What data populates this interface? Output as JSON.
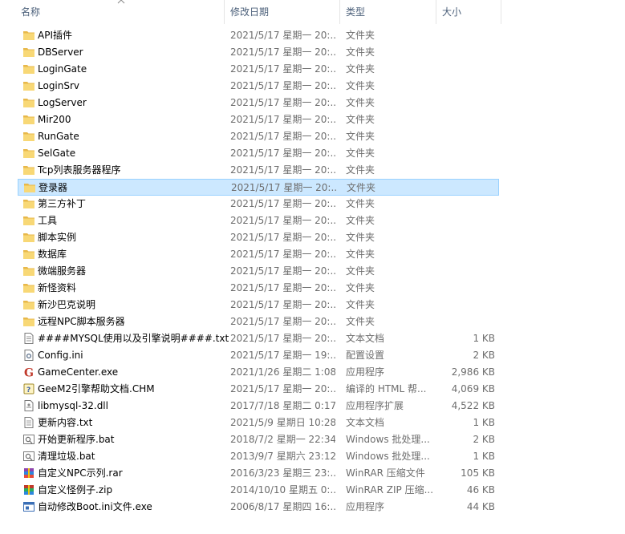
{
  "columns": {
    "name": "名称",
    "date": "修改日期",
    "type": "类型",
    "size": "大小"
  },
  "selected_index": 9,
  "icon_colors": {
    "folder": "#f8d876",
    "folder_dark": "#e8b84a",
    "selected_bg": "#cce8ff"
  },
  "rows": [
    {
      "name": "API插件",
      "date": "2021/5/17 星期一 20:...",
      "type": "文件夹",
      "size": "",
      "icon": "folder-icon"
    },
    {
      "name": "DBServer",
      "date": "2021/5/17 星期一 20:...",
      "type": "文件夹",
      "size": "",
      "icon": "folder-icon"
    },
    {
      "name": "LoginGate",
      "date": "2021/5/17 星期一 20:...",
      "type": "文件夹",
      "size": "",
      "icon": "folder-icon"
    },
    {
      "name": "LoginSrv",
      "date": "2021/5/17 星期一 20:...",
      "type": "文件夹",
      "size": "",
      "icon": "folder-icon"
    },
    {
      "name": "LogServer",
      "date": "2021/5/17 星期一 20:...",
      "type": "文件夹",
      "size": "",
      "icon": "folder-icon"
    },
    {
      "name": "Mir200",
      "date": "2021/5/17 星期一 20:...",
      "type": "文件夹",
      "size": "",
      "icon": "folder-icon"
    },
    {
      "name": "RunGate",
      "date": "2021/5/17 星期一 20:...",
      "type": "文件夹",
      "size": "",
      "icon": "folder-icon"
    },
    {
      "name": "SelGate",
      "date": "2021/5/17 星期一 20:...",
      "type": "文件夹",
      "size": "",
      "icon": "folder-icon"
    },
    {
      "name": "Tcp列表服务器程序",
      "date": "2021/5/17 星期一 20:...",
      "type": "文件夹",
      "size": "",
      "icon": "folder-icon"
    },
    {
      "name": "登录器",
      "date": "2021/5/17 星期一 20:...",
      "type": "文件夹",
      "size": "",
      "icon": "folder-icon"
    },
    {
      "name": "第三方补丁",
      "date": "2021/5/17 星期一 20:...",
      "type": "文件夹",
      "size": "",
      "icon": "folder-icon"
    },
    {
      "name": "工具",
      "date": "2021/5/17 星期一 20:...",
      "type": "文件夹",
      "size": "",
      "icon": "folder-icon"
    },
    {
      "name": "脚本实例",
      "date": "2021/5/17 星期一 20:...",
      "type": "文件夹",
      "size": "",
      "icon": "folder-icon"
    },
    {
      "name": "数据库",
      "date": "2021/5/17 星期一 20:...",
      "type": "文件夹",
      "size": "",
      "icon": "folder-icon"
    },
    {
      "name": "微端服务器",
      "date": "2021/5/17 星期一 20:...",
      "type": "文件夹",
      "size": "",
      "icon": "folder-icon"
    },
    {
      "name": "新怪资料",
      "date": "2021/5/17 星期一 20:...",
      "type": "文件夹",
      "size": "",
      "icon": "folder-icon"
    },
    {
      "name": "新沙巴克说明",
      "date": "2021/5/17 星期一 20:...",
      "type": "文件夹",
      "size": "",
      "icon": "folder-icon"
    },
    {
      "name": "远程NPC脚本服务器",
      "date": "2021/5/17 星期一 20:...",
      "type": "文件夹",
      "size": "",
      "icon": "folder-icon"
    },
    {
      "name": "####MYSQL使用以及引擎说明####.txt",
      "date": "2021/5/17 星期一 20:...",
      "type": "文本文档",
      "size": "1 KB",
      "icon": "text-file-icon"
    },
    {
      "name": "Config.ini",
      "date": "2021/5/17 星期一 19:...",
      "type": "配置设置",
      "size": "2 KB",
      "icon": "config-file-icon"
    },
    {
      "name": "GameCenter.exe",
      "date": "2021/1/26 星期二 1:08",
      "type": "应用程序",
      "size": "2,986 KB",
      "icon": "g-app-icon"
    },
    {
      "name": "GeeM2引擎帮助文档.CHM",
      "date": "2021/5/17 星期一 20:...",
      "type": "编译的 HTML 帮...",
      "size": "4,069 KB",
      "icon": "help-file-icon"
    },
    {
      "name": "libmysql-32.dll",
      "date": "2017/7/18 星期二 0:17",
      "type": "应用程序扩展",
      "size": "4,522 KB",
      "icon": "dll-file-icon"
    },
    {
      "name": "更新内容.txt",
      "date": "2021/5/9 星期日 10:28",
      "type": "文本文档",
      "size": "1 KB",
      "icon": "text-file-icon"
    },
    {
      "name": "开始更新程序.bat",
      "date": "2018/7/2 星期一 22:34",
      "type": "Windows 批处理...",
      "size": "2 KB",
      "icon": "bat-file-icon"
    },
    {
      "name": "清理垃圾.bat",
      "date": "2013/9/7 星期六 23:12",
      "type": "Windows 批处理...",
      "size": "1 KB",
      "icon": "bat-file-icon"
    },
    {
      "name": "自定义NPC示列.rar",
      "date": "2016/3/23 星期三 23:...",
      "type": "WinRAR 压缩文件",
      "size": "105 KB",
      "icon": "rar-archive-icon"
    },
    {
      "name": "自定义怪例子.zip",
      "date": "2014/10/10 星期五 0:...",
      "type": "WinRAR ZIP 压缩...",
      "size": "46 KB",
      "icon": "zip-archive-icon"
    },
    {
      "name": "自动修改Boot.ini文件.exe",
      "date": "2006/8/17 星期四 16:...",
      "type": "应用程序",
      "size": "44 KB",
      "icon": "exe-app-icon"
    }
  ]
}
